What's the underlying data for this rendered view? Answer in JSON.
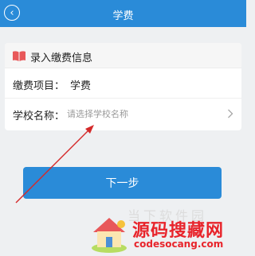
{
  "header": {
    "back_icon": "back-icon",
    "title": "学费"
  },
  "form": {
    "section_icon": "book-icon",
    "section_title": "录入缴费信息",
    "item_label": "缴费项目：",
    "item_value": "学费",
    "school_label": "学校名称：",
    "school_value": "",
    "school_placeholder": "请选择学校名称",
    "chevron_icon": "chevron-right-icon"
  },
  "actions": {
    "next_label": "下一步"
  },
  "watermark": {
    "faded_text": "当下软件园",
    "title": "源码搜藏网",
    "url": "codesocang.com"
  },
  "colors": {
    "primary": "#2a8bd8",
    "section_icon": "#e8585a",
    "annotation_arrow": "#d42a2a",
    "watermark_red": "#e8242b",
    "background": "#eef0f2"
  }
}
